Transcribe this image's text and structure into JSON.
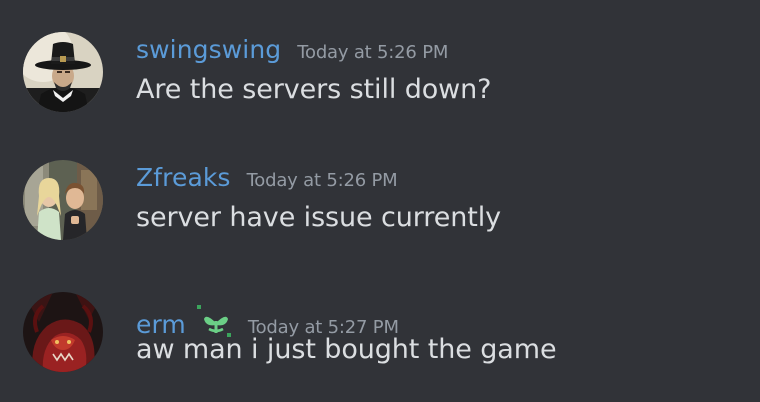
{
  "messages": [
    {
      "username": "swingswing",
      "timestamp": "Today at 5:26 PM",
      "text": "Are the servers still down?",
      "avatar": "pilgrim-hat-portrait-avatar"
    },
    {
      "username": "Zfreaks",
      "timestamp": "Today at 5:26 PM",
      "text": "server have issue currently",
      "avatar": "two-people-photo-avatar"
    },
    {
      "username": "erm",
      "timestamp": "Today at 5:27 PM",
      "text": "aw man i just bought the game",
      "avatar": "red-creature-avatar",
      "role_icon": "sprout-icon"
    }
  ],
  "colors": {
    "background": "#313338",
    "username": "#5b9bd8",
    "timestamp": "#949ba4",
    "message_text": "#dbdee1",
    "role_icon": "#3ba55c"
  }
}
